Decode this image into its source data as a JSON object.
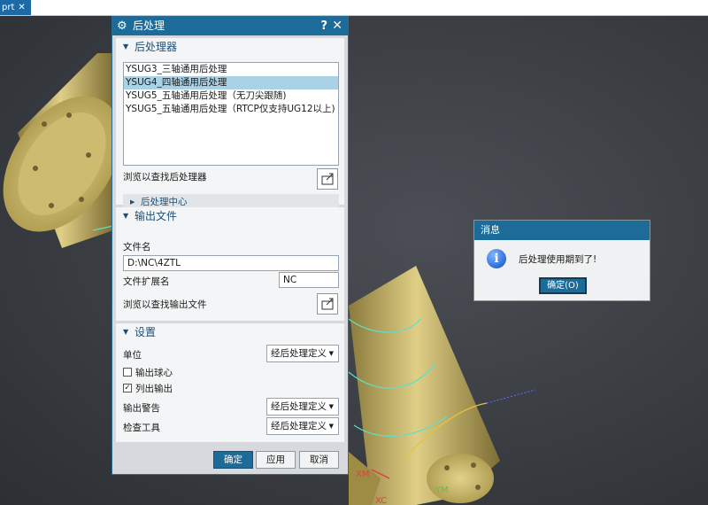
{
  "tab": {
    "label": "prt",
    "close": "✕"
  },
  "dialog": {
    "title": "后处理",
    "help": "?",
    "close": "✕",
    "groups": {
      "postprocessor": {
        "title": "后处理器",
        "items": [
          "YSUG3_三轴通用后处理",
          "YSUG4_四轴通用后处理",
          "YSUG5_五轴通用后处理（无刀尖跟随)",
          "YSUG5_五轴通用后处理（RTCP仅支持UG12以上)"
        ],
        "selected_index": 1,
        "browse_label": "浏览以查找后处理器",
        "center_label": "后处理中心"
      },
      "output": {
        "title": "输出文件",
        "filename_label": "文件名",
        "filename_value": "D:\\NC\\4ZTL",
        "ext_label": "文件扩展名",
        "ext_value": "NC",
        "browse_label": "浏览以查找输出文件"
      },
      "settings": {
        "title": "设置",
        "unit_label": "单位",
        "unit_value": "经后处理定义",
        "ballcenter_label": "输出球心",
        "ballcenter_checked": false,
        "listing_label": "列出输出",
        "listing_checked": true,
        "warning_label": "输出警告",
        "warning_value": "经后处理定义",
        "check_label": "检查工具",
        "check_value": "经后处理定义"
      }
    },
    "buttons": {
      "ok": "确定",
      "apply": "应用",
      "cancel": "取消"
    }
  },
  "message": {
    "title": "消息",
    "text": "后处理使用期到了!",
    "ok_label": "确定(O)"
  },
  "axes": {
    "xm": "XM",
    "xc": "XC",
    "ym": "YM"
  },
  "colors": {
    "accent": "#1d6b98",
    "selection": "#aad2e6",
    "part": "#c8b46a"
  }
}
